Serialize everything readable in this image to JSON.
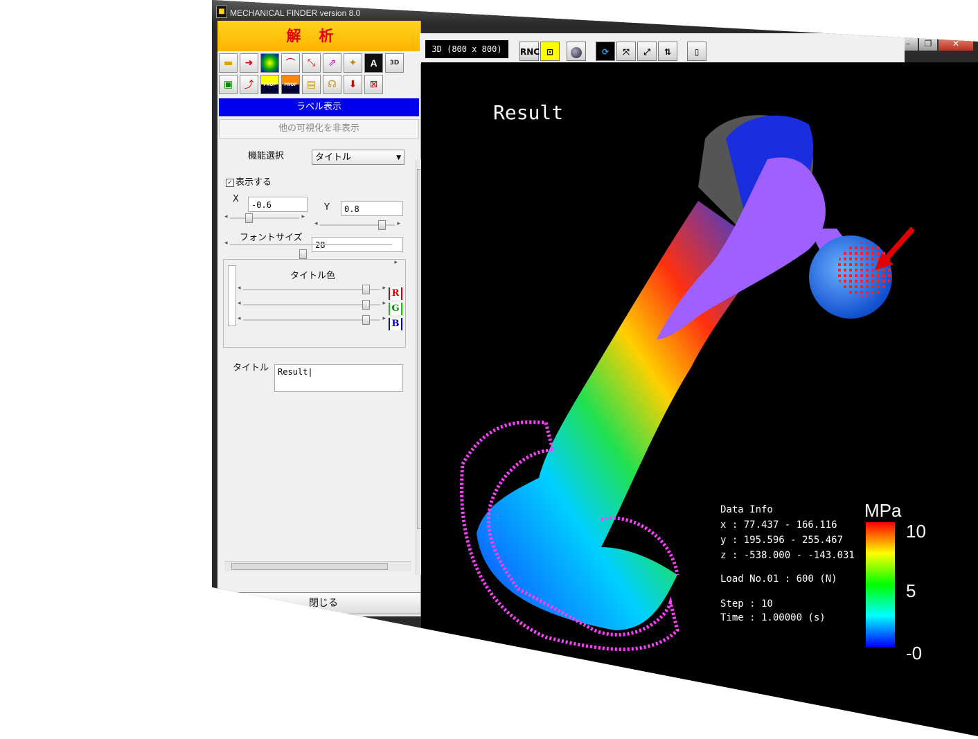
{
  "window": {
    "title": "MECHANICAL FINDER version 8.0",
    "controls": [
      "–",
      "❐",
      "✕"
    ]
  },
  "panel": {
    "header": "解析",
    "toolbar_row1_icons": [
      "folder-icon",
      "import-arrow-icon",
      "contour-map-icon",
      "cross-section-icon",
      "vector-icon",
      "principal-stress-icon",
      "magic-wand-icon",
      "text-label-icon",
      "3d-view-icon"
    ],
    "text_label_glyph": "A",
    "toolbar_row2_icons": [
      "export-icon",
      "path-icon",
      "prop-icon",
      "prop-burst-icon",
      "material-icon",
      "bone-icon",
      "load-arrow-icon",
      "mesh-grid-icon"
    ],
    "prop_text": "PROP",
    "label_banner": "ラベル表示",
    "hide_others_button": "他の可視化を非表示",
    "function_select_label": "機能選択",
    "function_select_value": "タイトル",
    "show_checkbox_label": "表示する",
    "x_label": "X",
    "x_value": "-0.6",
    "y_label": "Y",
    "y_value": "0.8",
    "font_size_label": "フォントサイズ",
    "font_size_value": "28",
    "title_color_label": "タイトル色",
    "r_label": "R",
    "g_label": "G",
    "b_label": "B",
    "title_label": "タイトル",
    "title_value": "Result",
    "close_button": "閉じる"
  },
  "toolbar": {
    "view_label": "3D (800 x 800)",
    "rnc_label": "RNC",
    "icons": [
      "fit-icon",
      "sphere-icon",
      "rotate-icon",
      "zoom-region-icon",
      "scale-icon",
      "layout-icon",
      "snapshot-icon"
    ]
  },
  "viewport": {
    "title": "Result",
    "data_info_lines": [
      "Data Info",
      "x : 77.437 - 166.116",
      "y : 195.596 - 255.467",
      "z : -538.000 - -143.031"
    ],
    "load_line": "Load No.01 : 600 (N)",
    "step_line": "Step : 10",
    "time_line": "Time : 1.00000 (s)",
    "legend": {
      "unit": "MPa",
      "max": "10",
      "mid": "5",
      "min": "-0",
      "colors": [
        "#ff0000",
        "#ffff00",
        "#00ff00",
        "#00ffff",
        "#0000ff"
      ]
    }
  }
}
